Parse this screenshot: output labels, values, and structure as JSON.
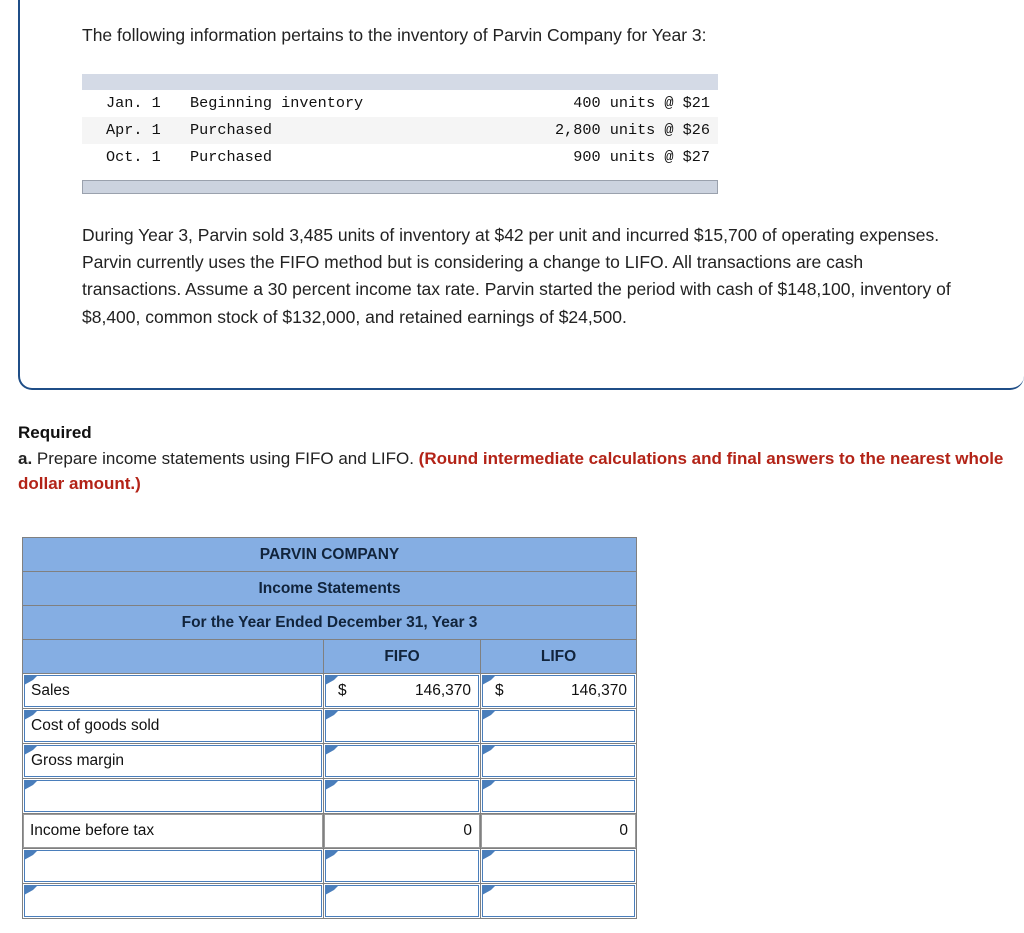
{
  "problem": {
    "intro": "The following information pertains to the inventory of Parvin Company for Year 3:",
    "inventory_table": {
      "rows": [
        {
          "date": "Jan. 1",
          "description": "Beginning inventory",
          "amount": "  400 units @ $21"
        },
        {
          "date": "Apr. 1",
          "description": "Purchased",
          "amount": "2,800 units @ $26"
        },
        {
          "date": "Oct. 1",
          "description": "Purchased",
          "amount": "  900 units @ $27"
        }
      ]
    },
    "paragraph": "During Year 3, Parvin sold 3,485 units of inventory at $42 per unit and incurred $15,700 of operating expenses. Parvin currently uses the FIFO method but is considering a change to LIFO. All transactions are cash transactions. Assume a 30 percent income tax rate. Parvin started the period with cash of $148,100, inventory of $8,400, common stock of $132,000, and retained earnings of $24,500."
  },
  "required": {
    "heading": "Required",
    "item_letter": "a.",
    "item_text": "Prepare income statements using FIFO and LIFO.",
    "note": "(Round intermediate calculations and final answers to the nearest whole dollar amount.)",
    "note_color": "#b32317"
  },
  "worksheet": {
    "title_line1": "PARVIN COMPANY",
    "title_line2": "Income Statements",
    "title_line3": "For the Year Ended December 31, Year 3",
    "header_accent": "#85aee3",
    "columns": [
      "",
      "FIFO",
      "LIFO"
    ],
    "rows": [
      {
        "label": "Sales",
        "label_editable": true,
        "fifo_currency": "$",
        "fifo": "146,370",
        "lifo_currency": "$",
        "lifo": "146,370",
        "editable": true,
        "rule": "none"
      },
      {
        "label": "Cost of goods sold",
        "label_editable": true,
        "fifo_currency": "",
        "fifo": "",
        "lifo_currency": "",
        "lifo": "",
        "editable": true,
        "rule": "single"
      },
      {
        "label": "Gross margin",
        "label_editable": true,
        "fifo_currency": "",
        "fifo": "",
        "lifo_currency": "",
        "lifo": "",
        "editable": true,
        "rule": "none"
      },
      {
        "label": "",
        "label_editable": true,
        "fifo_currency": "",
        "fifo": "",
        "lifo_currency": "",
        "lifo": "",
        "editable": true,
        "rule": "single"
      },
      {
        "label": "Income before tax",
        "label_editable": false,
        "fifo_currency": "",
        "fifo": "0",
        "lifo_currency": "",
        "lifo": "0",
        "editable": false,
        "rule": "none"
      },
      {
        "label": "",
        "label_editable": true,
        "fifo_currency": "",
        "fifo": "",
        "lifo_currency": "",
        "lifo": "",
        "editable": true,
        "rule": "single"
      },
      {
        "label": "",
        "label_editable": true,
        "fifo_currency": "",
        "fifo": "",
        "lifo_currency": "",
        "lifo": "",
        "editable": true,
        "rule": "double"
      }
    ]
  }
}
